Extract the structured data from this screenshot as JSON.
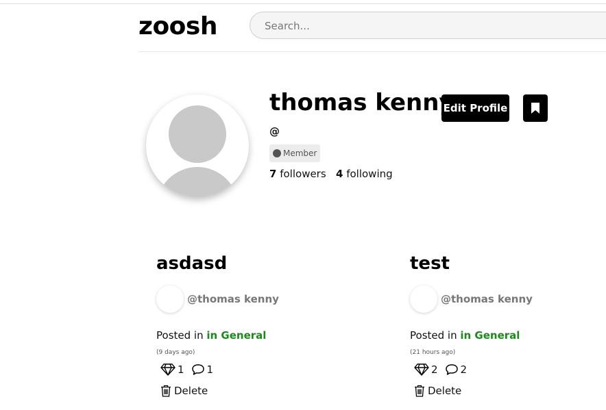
{
  "header": {
    "logo": "zoosh",
    "search_placeholder": "Search..."
  },
  "profile": {
    "name": "thomas kenny",
    "handle": "@",
    "badge": "Member",
    "followers_count": "7",
    "followers_label": "followers",
    "following_count": "4",
    "following_label": "following",
    "edit_label": "Edit Profile"
  },
  "posts": [
    {
      "title": "asdasd",
      "author": "@thomas kenny",
      "posted_prefix": "Posted in",
      "category": "in General",
      "ago": "(9 days ago)",
      "likes": "1",
      "comments": "1",
      "delete_label": "Delete"
    },
    {
      "title": "test",
      "author": "@thomas kenny",
      "posted_prefix": "Posted in",
      "category": "in General",
      "ago": "(21 hours ago)",
      "likes": "2",
      "comments": "2",
      "delete_label": "Delete"
    }
  ],
  "colors": {
    "category": "#1a8a1a",
    "button_bg": "#000000",
    "author_text": "#777777"
  },
  "icons": {
    "bookmark": "bookmark-icon",
    "like": "diamond-icon",
    "comment": "comment-icon",
    "delete": "trash-icon"
  }
}
